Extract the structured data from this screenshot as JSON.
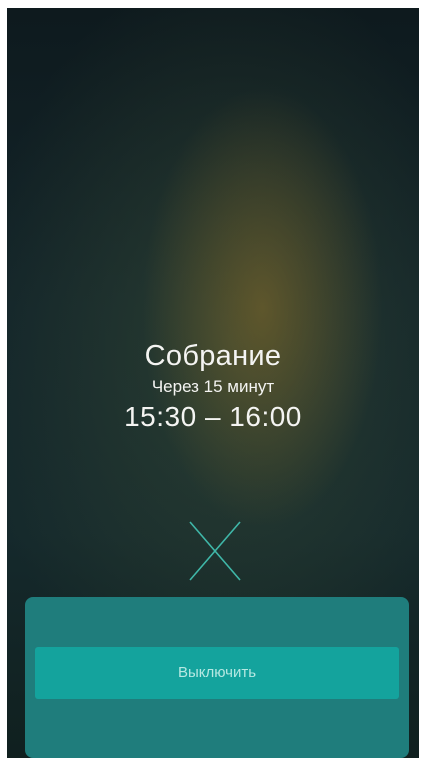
{
  "reminder": {
    "title": "Собрание",
    "subtitle": "Через 15 минут",
    "time_range": "15:30 – 16:00"
  },
  "dismiss": {
    "icon": "close-icon"
  },
  "actions": {
    "turn_off_label": "Выключить"
  },
  "colors": {
    "background_dark": "#13252a",
    "panel": "#1f7d7c",
    "button": "#14a39d",
    "button_text": "#b6e8e2",
    "icon_stroke": "#3fb7a8"
  }
}
